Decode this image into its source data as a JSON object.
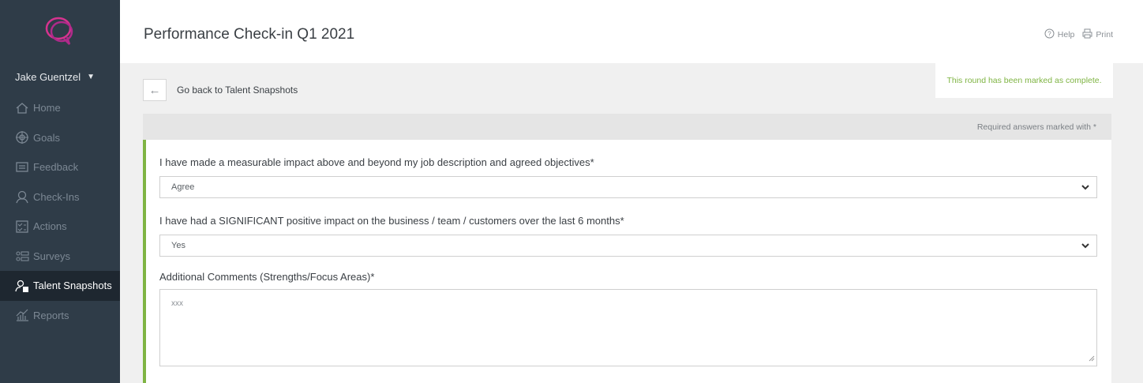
{
  "app": {
    "title": "Performance Check-in Q1 2021"
  },
  "user": {
    "name": "Jake Guentzel"
  },
  "sidebar": {
    "items": [
      {
        "label": "Home",
        "icon": "home-icon"
      },
      {
        "label": "Goals",
        "icon": "target-icon"
      },
      {
        "label": "Feedback",
        "icon": "feedback-icon"
      },
      {
        "label": "Check-Ins",
        "icon": "people-icon"
      },
      {
        "label": "Actions",
        "icon": "checklist-icon"
      },
      {
        "label": "Surveys",
        "icon": "survey-icon"
      },
      {
        "label": "Talent Snapshots",
        "icon": "talent-icon",
        "active": true
      },
      {
        "label": "Reports",
        "icon": "chart-icon"
      }
    ]
  },
  "header": {
    "help_label": "Help",
    "print_label": "Print"
  },
  "nav": {
    "back_label": "Go back to Talent Snapshots"
  },
  "status": {
    "complete_message": "This round has been marked as complete."
  },
  "form": {
    "required_note": "Required answers marked with *",
    "q1": {
      "label": "I have made a measurable impact above and beyond my job description and agreed objectives*",
      "value": "Agree"
    },
    "q2": {
      "label": "I have had a SIGNIFICANT positive impact on the business / team / customers over the last 6 months*",
      "value": "Yes"
    },
    "q3": {
      "label": "Additional Comments (Strengths/Focus Areas)*",
      "value": "xxx"
    }
  },
  "colors": {
    "sidebar_bg": "#2f3c48",
    "accent_green": "#7fb443",
    "logo_pink": "#d6338f"
  }
}
